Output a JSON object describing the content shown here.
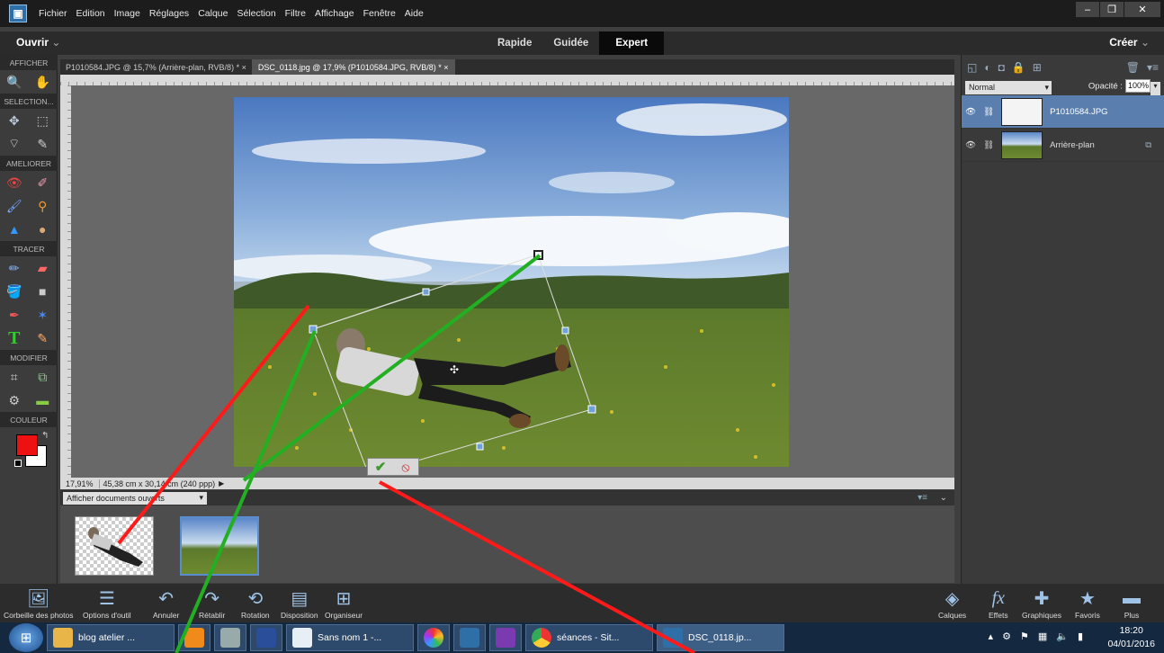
{
  "menubar": {
    "items": [
      "Fichier",
      "Edition",
      "Image",
      "Réglages",
      "Calque",
      "Sélection",
      "Filtre",
      "Affichage",
      "Fenêtre",
      "Aide"
    ]
  },
  "modebar": {
    "open": "Ouvrir",
    "tabs": [
      "Rapide",
      "Guidée",
      "Expert"
    ],
    "active_tab": "Expert",
    "create": "Créer"
  },
  "toolbox": {
    "sections": [
      "AFFICHER",
      "SELECTION...",
      "AMELIORER",
      "TRACER",
      "MODIFIER",
      "COULEUR"
    ]
  },
  "documents": {
    "tabs": [
      "P1010584.JPG @ 15,7% (Arrière-plan, RVB/8) *",
      "DSC_0118.jpg @ 17,9% (P1010584.JPG, RVB/8) *"
    ],
    "active": 1
  },
  "status": {
    "zoom": "17,91%",
    "doc_size": "45,38 cm x 30,14 cm (240 ppp)"
  },
  "bin": {
    "dropdown": "Afficher documents ouverts"
  },
  "layers": {
    "blend_mode": "Normal",
    "opacity_label": "Opacité :",
    "opacity_value": "100%",
    "items": [
      {
        "name": "P1010584.JPG",
        "selected": true
      },
      {
        "name": "Arrière-plan",
        "selected": false
      }
    ]
  },
  "bottom_left": [
    "Corbeille des photos",
    "Options d'outil",
    "Annuler",
    "Rétablir",
    "Rotation",
    "Disposition",
    "Organiseur"
  ],
  "bottom_right": [
    "Calques",
    "Effets",
    "Graphiques",
    "Favoris",
    "Plus"
  ],
  "taskbar": {
    "items": [
      "blog atelier ...",
      "Sans nom 1 -...",
      "séances - Sit...",
      "DSC_0118.jp..."
    ],
    "time": "18:20",
    "date": "04/01/2016"
  },
  "colors": {
    "foreground": "#ee1111",
    "background": "#ffffff",
    "selected_layer": "#5a7fae",
    "annotation_red": "#ff1a1a",
    "annotation_green": "#22b022"
  }
}
